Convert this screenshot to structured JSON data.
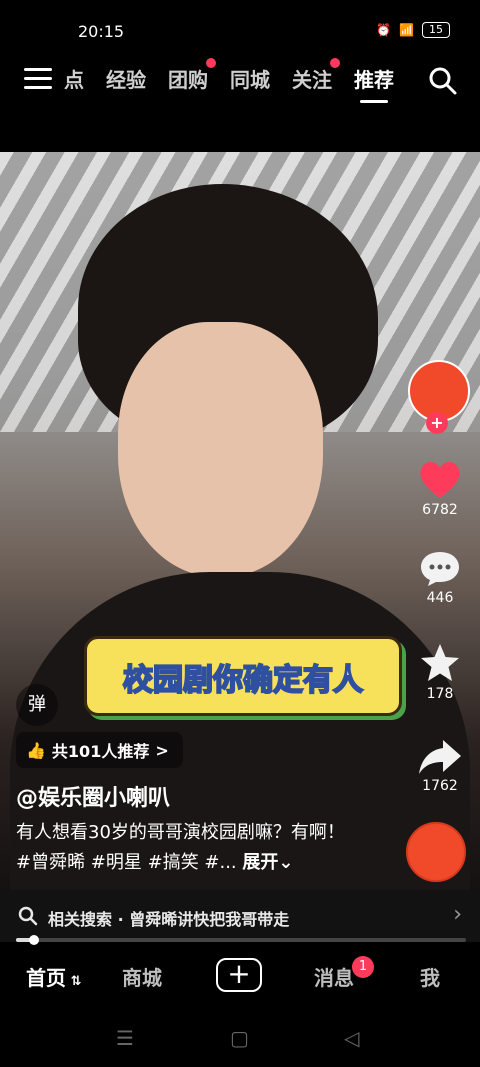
{
  "status": {
    "time": "20:15",
    "battery": "15"
  },
  "topnav": {
    "tabs": [
      {
        "label": "点",
        "dot": false
      },
      {
        "label": "经验",
        "dot": false
      },
      {
        "label": "团购",
        "dot": true
      },
      {
        "label": "同城",
        "dot": false
      },
      {
        "label": "关注",
        "dot": true
      },
      {
        "label": "推荐",
        "active": true
      }
    ]
  },
  "video": {
    "overlay_caption": "校园剧你确定有人"
  },
  "danmu": {
    "label": "弹"
  },
  "recommend": {
    "label": "共101人推荐",
    "chevron": ">"
  },
  "author": "@娱乐圈小喇叭",
  "description": {
    "text": "有人想看30岁的哥哥演校园剧嘛？有啊！#曾舜晞 #明星 #搞笑 #...",
    "more": "展开"
  },
  "actions": {
    "likes": "6782",
    "comments": "446",
    "favorites": "178",
    "shares": "1762"
  },
  "related_search": {
    "label": "相关搜索 · 曾舜晞讲快把我哥带走"
  },
  "progress": {
    "fraction": 0.04
  },
  "bottomnav": {
    "home": "首页",
    "mall": "商城",
    "messages": "消息",
    "messages_badge": "1",
    "me": "我"
  },
  "colors": {
    "accent": "#ff3b5c"
  }
}
